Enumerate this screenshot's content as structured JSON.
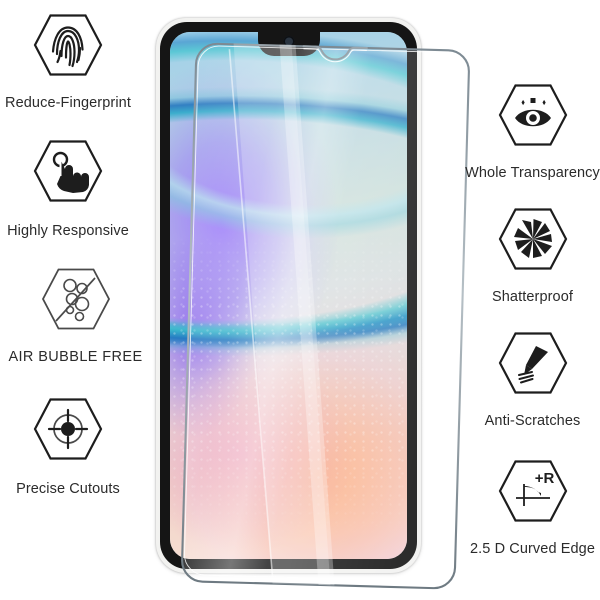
{
  "page": {
    "title": "Tempered Glass Screen Protector Feature Grid",
    "background_color": "#ffffff",
    "text_color": "#2b2b2b"
  },
  "features_left": [
    {
      "id": "reduce-fingerprint",
      "label": "Reduce-Fingerprint",
      "icon": "fingerprint-icon"
    },
    {
      "id": "highly-responsive",
      "label": "Highly Responsive",
      "icon": "touch-hand-icon"
    },
    {
      "id": "air-bubble-free",
      "label": "AIR BUBBLE FREE",
      "icon": "bubbles-icon"
    },
    {
      "id": "precise-cutouts",
      "label": "Precise Cutouts",
      "icon": "crosshair-icon"
    }
  ],
  "features_right": [
    {
      "id": "whole-transparency",
      "label": "Whole Transparency",
      "icon": "eye-icon"
    },
    {
      "id": "shatterproof",
      "label": "Shatterproof",
      "icon": "shattered-glass-icon"
    },
    {
      "id": "anti-scratches",
      "label": "Anti-Scratches",
      "icon": "knife-scratch-icon"
    },
    {
      "id": "curved-edge",
      "label": "2.5 D Curved Edge",
      "icon": "radius-edge-icon"
    }
  ],
  "product": {
    "device": "smartphone-with-waterdrop-notch",
    "overlay": "tempered-glass-screen-protector",
    "bezel_color": "#151515",
    "frame_color": "#f2f2f0",
    "radius_badge_text": "+R"
  }
}
